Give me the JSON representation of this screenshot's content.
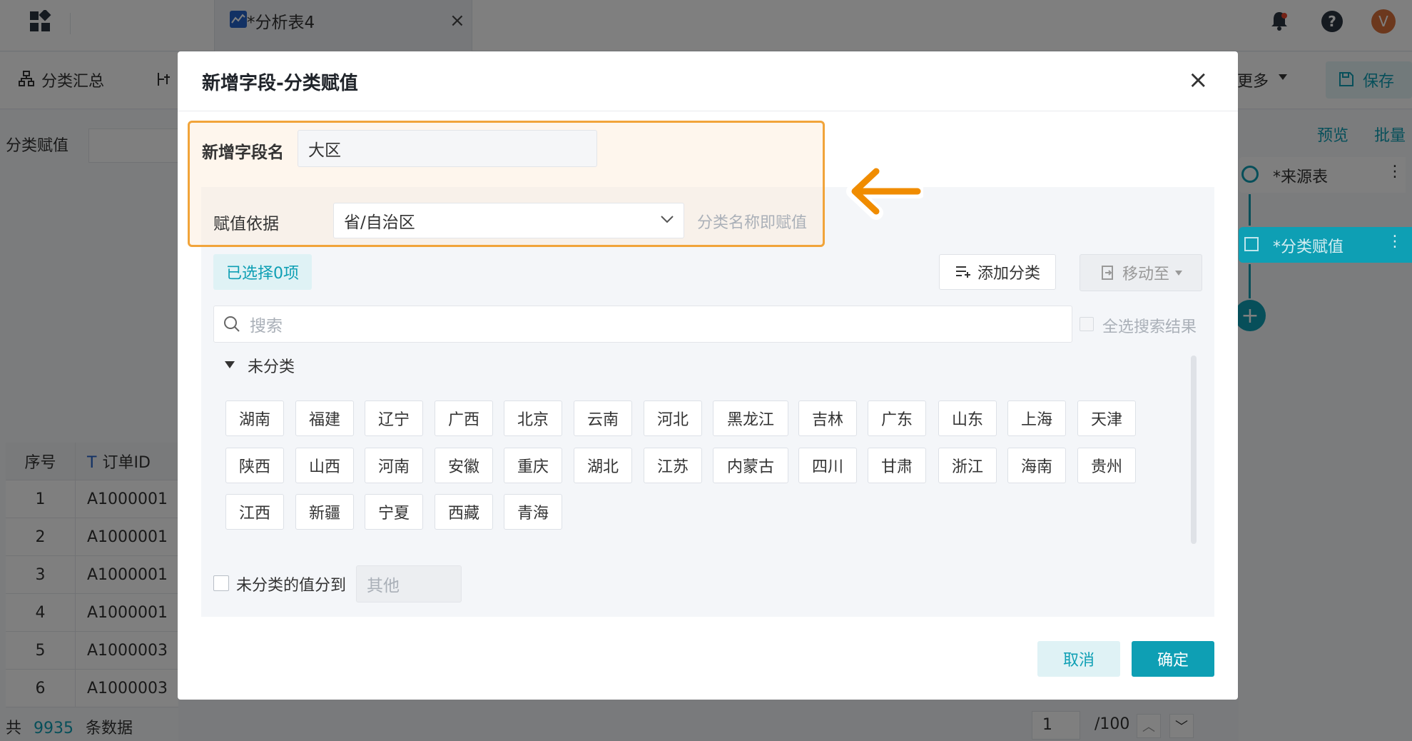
{
  "topbar": {
    "tab_title": "*分析表4",
    "tab_close": "×",
    "avatar_letter": "V"
  },
  "toolbar": {
    "classify_summary": "分类汇总",
    "more": "更多",
    "save": "保存"
  },
  "left": {
    "section_label": "分类赋值",
    "table_headers": [
      "序号",
      "订单ID"
    ],
    "rows": [
      [
        "1",
        "A1000001"
      ],
      [
        "2",
        "A1000001"
      ],
      [
        "3",
        "A1000001"
      ],
      [
        "4",
        "A1000001"
      ],
      [
        "5",
        "A1000003"
      ],
      [
        "6",
        "A1000003"
      ]
    ]
  },
  "footer": {
    "total_prefix": "共",
    "total_count": "9935",
    "total_suffix": "条数据",
    "page": "1",
    "page_total": "/100"
  },
  "right": {
    "preview": "预览",
    "batch": "批量",
    "node_source": "*来源表",
    "node_classify": "*分类赋值"
  },
  "dialog": {
    "title": "新增字段-分类赋值",
    "close": "×",
    "field_name_label": "新增字段名",
    "field_name_value": "大区",
    "basis_label": "赋值依据",
    "basis_value": "省/自治区",
    "basis_hint": "分类名称即赋值",
    "selected_count": "已选择0项",
    "add_category": "添加分类",
    "move_to": "移动至",
    "search_placeholder": "搜索",
    "select_all_label": "全选搜索结果",
    "group_label": "未分类",
    "provinces": [
      [
        "湖南",
        "福建",
        "辽宁",
        "广西",
        "北京",
        "云南",
        "河北",
        "黑龙江",
        "吉林",
        "广东",
        "山东",
        "上海",
        "天津"
      ],
      [
        "陕西",
        "山西",
        "河南",
        "安徽",
        "重庆",
        "湖北",
        "江苏",
        "内蒙古",
        "四川",
        "甘肃",
        "浙江",
        "海南",
        "贵州"
      ],
      [
        "江西",
        "新疆",
        "宁夏",
        "西藏",
        "青海"
      ]
    ],
    "unclassified_label": "未分类的值分到",
    "unclassified_value": "其他",
    "cancel": "取消",
    "confirm": "确定"
  },
  "colors": {
    "accent": "#0e9fb4",
    "highlight_border": "#f1a43a",
    "arrow": "#f08c00"
  }
}
